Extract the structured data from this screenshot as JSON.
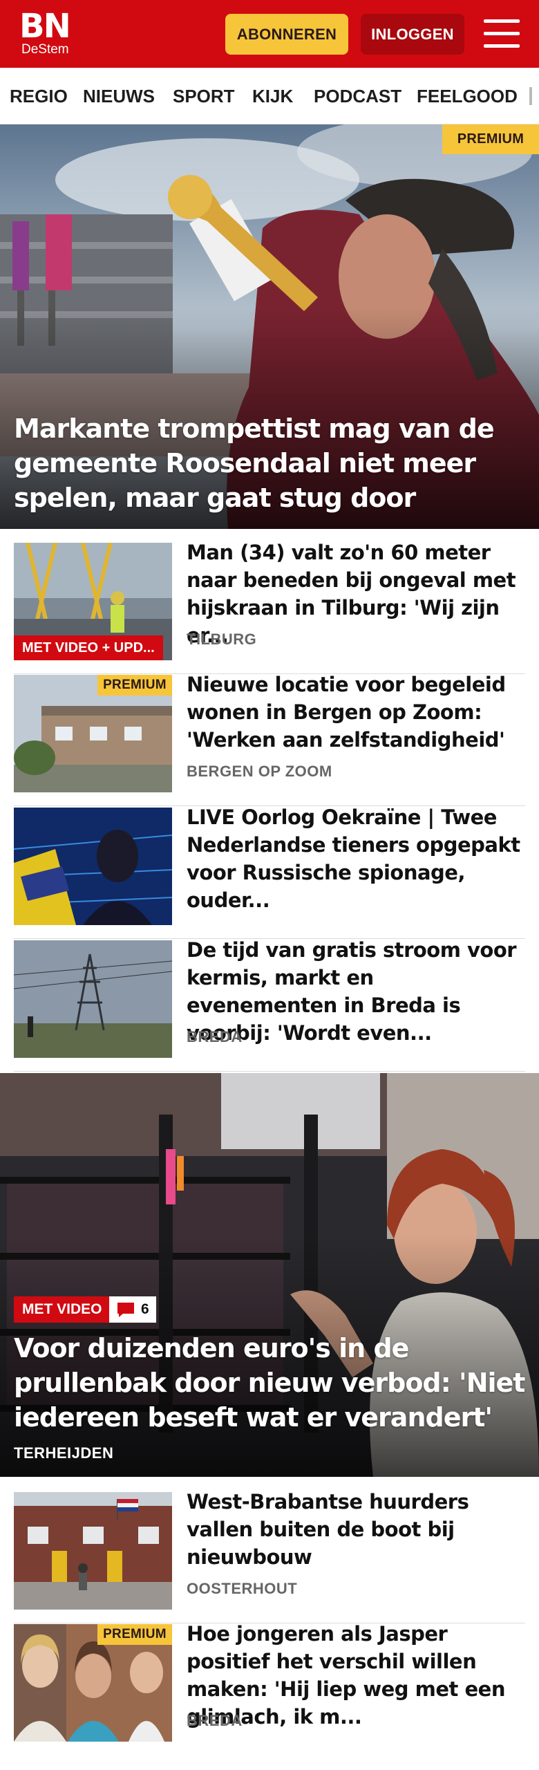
{
  "header": {
    "logo_main": "BN",
    "logo_sub": "DeStem",
    "subscribe_label": "ABONNEREN",
    "login_label": "INLOGGEN",
    "menu_icon": "hamburger-menu-icon",
    "brand_color": "#d10a11",
    "accent_color": "#f7c53a"
  },
  "nav": {
    "items": [
      "REGIO",
      "NIEUWS",
      "SPORT",
      "KIJK",
      "PODCAST",
      "FEELGOOD"
    ]
  },
  "hero1": {
    "premium": "PREMIUM",
    "title": "Markante trompettist mag van de gemeente Roosendaal niet meer spelen, maar gaat stug door"
  },
  "articles": [
    {
      "title": "Man (34) valt zo'n 60 meter naar beneden bij ongeval met hijskraan in Tilburg: 'Wij zijn er...",
      "location": "TILBURG",
      "tag": "MET VIDEO + UPD..."
    },
    {
      "title": "Nieuwe locatie voor begeleid wonen in Bergen op Zoom: 'Werken aan zelfstandigheid'",
      "location": "BERGEN OP ZOOM",
      "premium": "PREMIUM"
    },
    {
      "title": "LIVE Oorlog Oekraïne | Twee Nederlandse tieners opgepakt voor Russische spionage, ouder..."
    },
    {
      "title": "De tijd van gratis stroom voor kermis, markt en evenementen in Breda is voorbij: 'Wordt even...",
      "location": "BREDA"
    }
  ],
  "hero2": {
    "video_tag": "MET VIDEO",
    "comment_count": "6",
    "comment_icon": "comment-bubble-icon",
    "title": "Voor duizenden euro's in de prullenbak door nieuw verbod: 'Niet iedereen beseft wat er verandert'",
    "location": "TERHEIJDEN"
  },
  "articles2": [
    {
      "title": "West-Brabantse huurders vallen buiten de boot bij nieuwbouw",
      "location": "OOSTERHOUT"
    },
    {
      "title": "Hoe jongeren als Jasper positief het verschil willen maken: 'Hij liep weg met een glimlach, ik m...",
      "location": "BREDA",
      "premium": "PREMIUM"
    }
  ]
}
